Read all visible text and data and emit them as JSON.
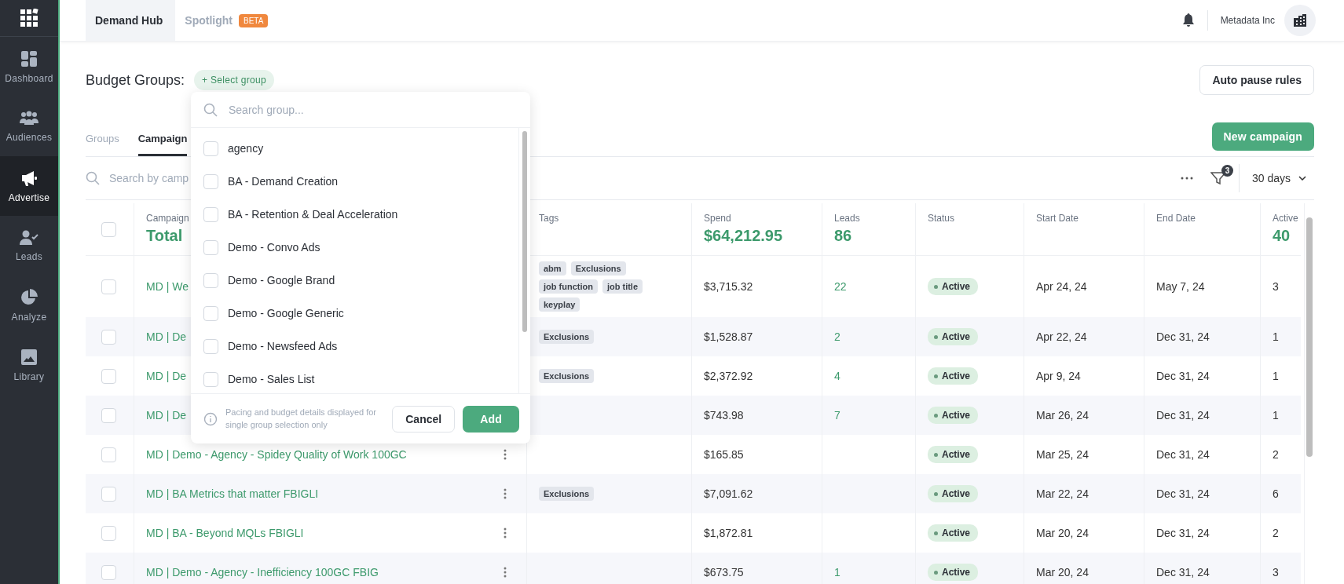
{
  "sidebar": {
    "items": [
      {
        "label": "Dashboard",
        "selected": false
      },
      {
        "label": "Audiences",
        "selected": false
      },
      {
        "label": "Advertise",
        "selected": true
      },
      {
        "label": "Leads",
        "selected": false
      },
      {
        "label": "Analyze",
        "selected": false
      },
      {
        "label": "Library",
        "selected": false
      }
    ]
  },
  "top_tabs": [
    {
      "label": "Demand Hub",
      "selected": true
    },
    {
      "label": "Spotlight",
      "selected": false,
      "badge": "BETA"
    }
  ],
  "account": {
    "name": "Metadata Inc"
  },
  "budget_groups": {
    "label": "Budget Groups:",
    "select_button": "+ Select group"
  },
  "auto_pause_button": "Auto pause rules",
  "view_tabs": [
    {
      "label": "Groups",
      "selected": false
    },
    {
      "label": "Campaign",
      "selected": true
    }
  ],
  "new_campaign_button": "New campaign",
  "search": {
    "placeholder": "Search by camp"
  },
  "filter_count": "3",
  "range": "30 days",
  "table": {
    "all_checked": false,
    "columns": [
      {
        "label": "Campaign",
        "total": "Total"
      },
      {
        "label": "Tags"
      },
      {
        "label": "Spend",
        "total": "$64,212.95"
      },
      {
        "label": "Leads",
        "total": "86"
      },
      {
        "label": "Status"
      },
      {
        "label": "Start Date"
      },
      {
        "label": "End Date"
      },
      {
        "label": "Active",
        "total": "40"
      }
    ],
    "rows": [
      {
        "name": "MD | We",
        "checked": false,
        "tags": [
          "abm",
          "Exclusions",
          "job function",
          "job title",
          "keyplay"
        ],
        "spend": "$3,715.32",
        "leads": "22",
        "status": "Active",
        "start": "Apr 24, 24",
        "end": "May 7, 24",
        "active": "3"
      },
      {
        "name": "MD | De",
        "checked": false,
        "tags": [
          "Exclusions"
        ],
        "spend": "$1,528.87",
        "leads": "2",
        "status": "Active",
        "start": "Apr 22, 24",
        "end": "Dec 31, 24",
        "active": "1"
      },
      {
        "name": "MD | De",
        "checked": false,
        "tags": [
          "Exclusions"
        ],
        "spend": "$2,372.92",
        "leads": "4",
        "status": "Active",
        "start": "Apr 9, 24",
        "end": "Dec 31, 24",
        "active": "1"
      },
      {
        "name": "MD | De",
        "checked": false,
        "tags": [],
        "spend": "$743.98",
        "leads": "7",
        "status": "Active",
        "start": "Mar 26, 24",
        "end": "Dec 31, 24",
        "active": "1"
      },
      {
        "name": "MD | Demo - Agency - Spidey Quality of Work 100GC",
        "checked": false,
        "actions_visible": true,
        "tags": [],
        "spend": "$165.85",
        "status": "Active",
        "start": "Mar 25, 24",
        "end": "Dec 31, 24",
        "active": "2"
      },
      {
        "name": "MD | BA Metrics that matter FBIGLI",
        "checked": false,
        "actions_visible": true,
        "tags": [
          "Exclusions"
        ],
        "spend": "$7,091.62",
        "status": "Active",
        "start": "Mar 22, 24",
        "end": "Dec 31, 24",
        "active": "6"
      },
      {
        "name": "MD | BA - Beyond MQLs FBIGLI",
        "checked": false,
        "actions_visible": true,
        "tags": [],
        "spend": "$1,872.81",
        "status": "Active",
        "start": "Mar 20, 24",
        "end": "Dec 31, 24",
        "active": "2"
      },
      {
        "name": "MD | Demo - Agency - Inefficiency 100GC FBIG",
        "checked": false,
        "actions_visible": true,
        "tags": [],
        "spend": "$673.75",
        "leads": "1",
        "status": "Active",
        "start": "Mar 20, 24",
        "end": "Dec 31, 24",
        "active": "3"
      }
    ]
  },
  "group_dropdown": {
    "placeholder": "Search group...",
    "options": [
      {
        "label": "agency",
        "checked": false
      },
      {
        "label": "BA - Demand Creation",
        "checked": false
      },
      {
        "label": "BA - Retention & Deal Acceleration",
        "checked": false
      },
      {
        "label": "Demo - Convo Ads",
        "checked": false
      },
      {
        "label": "Demo - Google Brand",
        "checked": false
      },
      {
        "label": "Demo - Google Generic",
        "checked": false
      },
      {
        "label": "Demo - Newsfeed Ads",
        "checked": false
      },
      {
        "label": "Demo - Sales List",
        "checked": false
      }
    ],
    "note": "Pacing and budget details displayed for single group selection only",
    "cancel_button": "Cancel",
    "add_button": "Add"
  }
}
